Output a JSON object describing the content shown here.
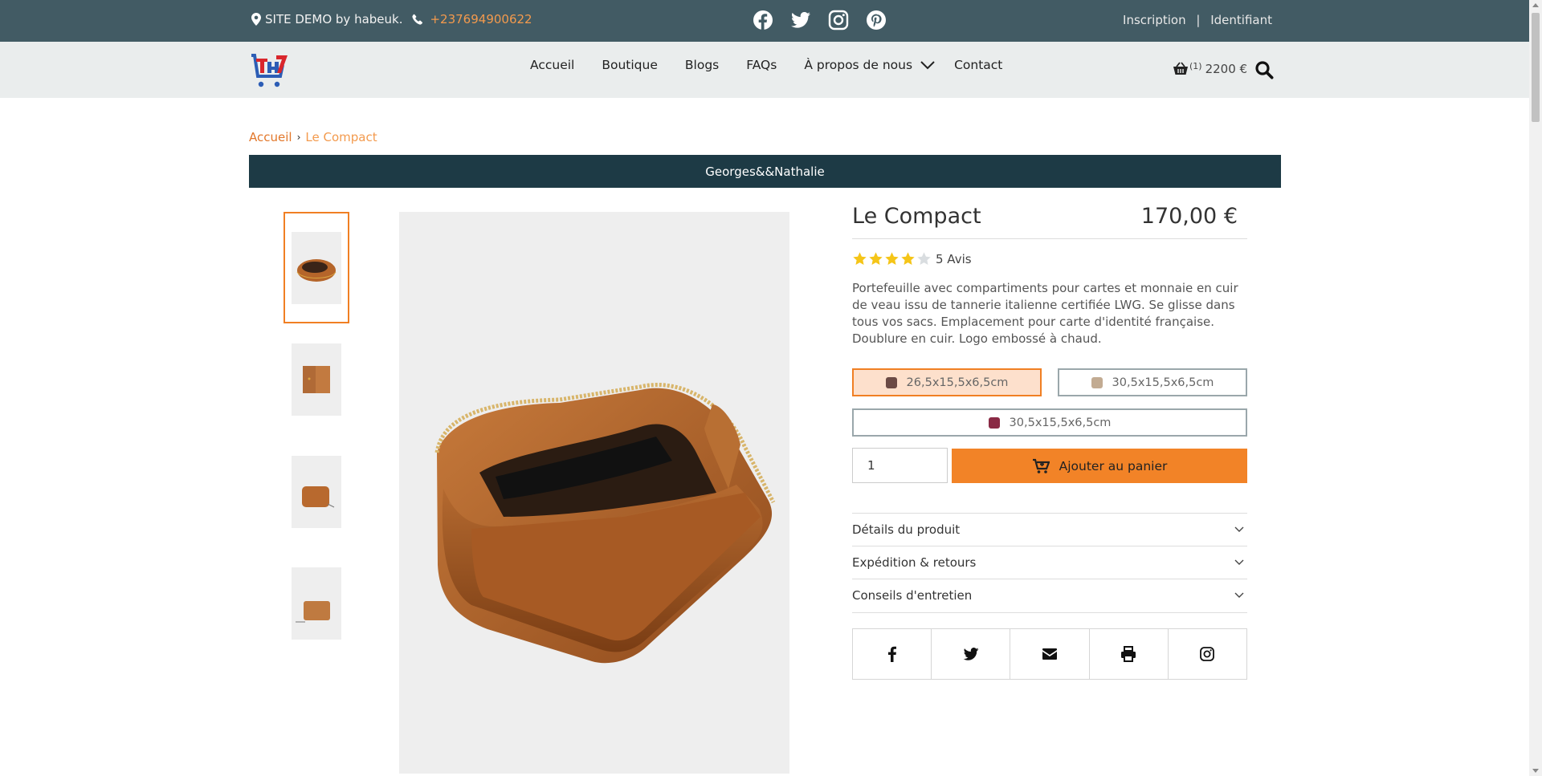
{
  "topbar": {
    "site_label": "SITE  DEMO by habeuk.",
    "phone": "+237694900622",
    "social": [
      "facebook-icon",
      "twitter-icon",
      "instagram-icon",
      "pinterest-icon"
    ],
    "signup": "Inscription",
    "separator": "|",
    "login": "Identifiant"
  },
  "nav": {
    "items": [
      "Accueil",
      "Boutique",
      "Blogs",
      "FAQs",
      "À propos de nous",
      "Contact"
    ]
  },
  "cart": {
    "count": "(1)",
    "total": "2200 €"
  },
  "breadcrumb": {
    "home": "Accueil",
    "current": "Le Compact"
  },
  "brand": "Georges&&Nathalie",
  "product": {
    "title": "Le Compact",
    "price": "170,00 €",
    "rating": 4,
    "rating_max": 5,
    "reviews": "5 Avis",
    "description": "Portefeuille avec compartiments pour cartes et monnaie en cuir de veau issu de tannerie italienne certifiée  LWG. Se glisse dans tous vos sacs. Emplacement pour carte d'identité française.  Doublure en cuir.  Logo embossé à chaud.",
    "variants": [
      {
        "label": "26,5x15,5x6,5cm",
        "color": "#6b4a45",
        "selected": true
      },
      {
        "label": "30,5x15,5x6,5cm",
        "color": "#c2ab92",
        "selected": false
      },
      {
        "label": "30,5x15,5x6,5cm",
        "color": "#8a2a45",
        "selected": false
      }
    ],
    "quantity": "1",
    "add_to_cart": "Ajouter au panier",
    "accordion": [
      "Détails du produit",
      "Expédition & retours",
      "Conseils d'entretien"
    ]
  },
  "share_icons": [
    "facebook-icon",
    "twitter-icon",
    "envelope-icon",
    "print-icon",
    "instagram-icon"
  ],
  "colors": {
    "topbar": "#425b64",
    "accent": "#f28327",
    "brandbar": "#1d3a45",
    "header": "#eaeded"
  }
}
